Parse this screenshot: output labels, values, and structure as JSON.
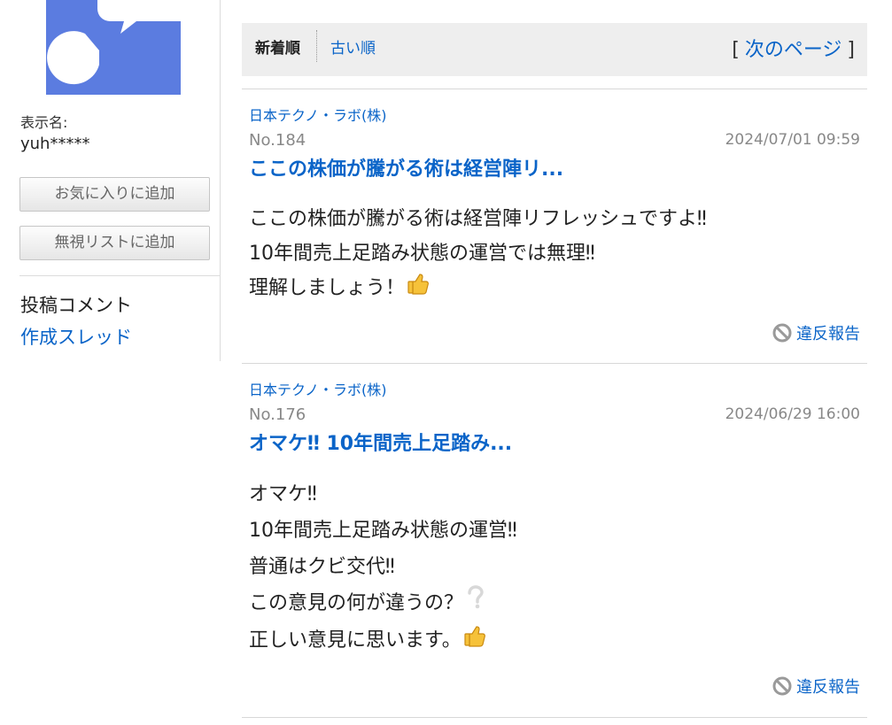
{
  "sidebar": {
    "display_name_label": "表示名:",
    "display_name_value": "yuh*****",
    "btn_favorite": "お気に入りに追加",
    "btn_ignore": "無視リストに追加",
    "nav_current": "投稿コメント",
    "nav_link": "作成スレッド"
  },
  "sort": {
    "active": "新着順",
    "old": "古い順",
    "bracket_open": "[",
    "next_page": "次のページ",
    "bracket_close": "]"
  },
  "posts": [
    {
      "company": "日本テクノ・ラボ(株)",
      "no": "No.184",
      "date": "2024/07/01 09:59",
      "title": "ここの株価が騰がる術は経営陣リ...",
      "lines": [
        "ここの株価が騰がる術は経営陣リフレッシュですよ‼",
        "10年間売上足踏み状態の運営では無理‼",
        "理解しましょう！"
      ],
      "report": "違反報告"
    },
    {
      "company": "日本テクノ・ラボ(株)",
      "no": "No.176",
      "date": "2024/06/29 16:00",
      "title": "オマケ‼ 10年間売上足踏み...",
      "lines": [
        "オマケ‼",
        "10年間売上足踏み状態の運営‼",
        "普通はクビ交代‼",
        "この意見の何が違うの？",
        "正しい意見に思います。"
      ],
      "report": "違反報告"
    }
  ],
  "icons": {
    "avatar": "speech-bubble-pacman-icon",
    "thumbs_up": "thumbs-up-icon",
    "question": "white-question-icon",
    "report": "prohibited-icon"
  },
  "colors": {
    "link": "#0a64c8",
    "avatar_bg": "#5b7ce0",
    "sortbar_bg": "#eeeeee"
  }
}
